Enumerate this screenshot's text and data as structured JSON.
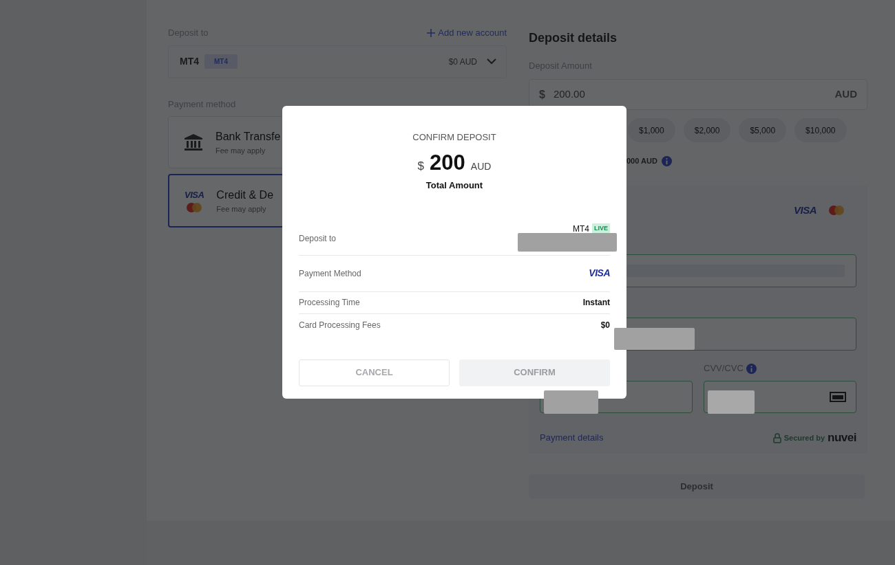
{
  "deposit_to": {
    "label": "Deposit to",
    "add_link": "Add new account",
    "account": {
      "name": "MT4",
      "badge": "MT4",
      "balance": "$0 AUD"
    }
  },
  "payment_method": {
    "label": "Payment method",
    "methods": [
      {
        "kind": "bank",
        "title": "Bank Transfe",
        "note": "Fee may apply",
        "selected": false
      },
      {
        "kind": "card",
        "brand": "VISA",
        "title": "Credit & De",
        "note": "Fee may apply",
        "selected": true
      }
    ]
  },
  "deposit_details": {
    "title": "Deposit details",
    "amount_label": "Deposit Amount",
    "currency_symbol": "$",
    "amount": "200.00",
    "currency": "AUD",
    "presets": [
      "$1,000",
      "$2,000",
      "$5,000",
      "$10,000"
    ],
    "limit_text": "000 AUD",
    "card_form": {
      "brand": "VISA",
      "cvv_label": "CVV/CVC",
      "payment_details_link": "Payment details",
      "secured_by": "Secured by",
      "provider": "nuvei"
    },
    "deposit_button": {
      "label": "Deposit",
      "disabled": true
    }
  },
  "modal": {
    "title": "CONFIRM DEPOSIT",
    "currency_symbol": "$",
    "amount": "200",
    "currency": "AUD",
    "subtitle": "Total Amount",
    "rows": [
      {
        "kind": "account",
        "label": "Deposit to",
        "value": "MT4",
        "badge": "LIVE"
      },
      {
        "kind": "brand",
        "label": "Payment Method",
        "value": "VISA"
      },
      {
        "kind": "text",
        "label": "Processing Time",
        "value": "Instant"
      },
      {
        "kind": "text",
        "label": "Card Processing Fees",
        "value": "$0"
      }
    ],
    "buttons": [
      {
        "kind": "outline",
        "label": "CANCEL",
        "disabled": true
      },
      {
        "kind": "filled",
        "label": "CONFIRM",
        "disabled": true
      }
    ]
  }
}
